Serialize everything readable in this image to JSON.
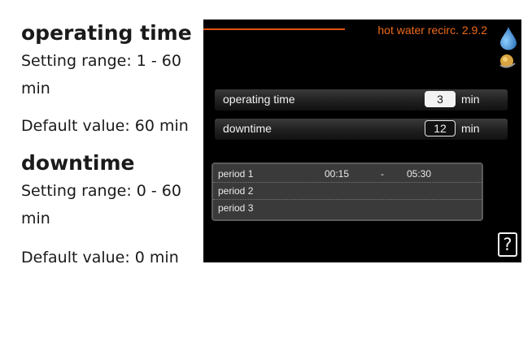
{
  "doc": {
    "heading1": "operating time",
    "range1": "Setting range: 1 - 60 min",
    "default1": "Default value: 60 min",
    "heading2": "downtime",
    "range2": "Setting range: 0 - 60 min",
    "default2": "Default value: 0 min"
  },
  "screen": {
    "title": "hot water recirc. 2.9.2",
    "rows": [
      {
        "label": "operating time",
        "value": "3",
        "unit": "min"
      },
      {
        "label": "downtime",
        "value": "12",
        "unit": "min"
      }
    ],
    "periods": [
      {
        "name": "period 1",
        "start": "00:15",
        "dash": "-",
        "end": "05:30"
      },
      {
        "name": "period 2",
        "start": "",
        "dash": "",
        "end": ""
      },
      {
        "name": "period 3",
        "start": "",
        "dash": "",
        "end": ""
      }
    ],
    "help_label": "?"
  },
  "colors": {
    "accent": "#f06a1a",
    "screen_bg": "#000000",
    "drop_icon": "#3a8fd6"
  },
  "icons": [
    "water-drop-icon",
    "sun-icon",
    "help-icon"
  ]
}
